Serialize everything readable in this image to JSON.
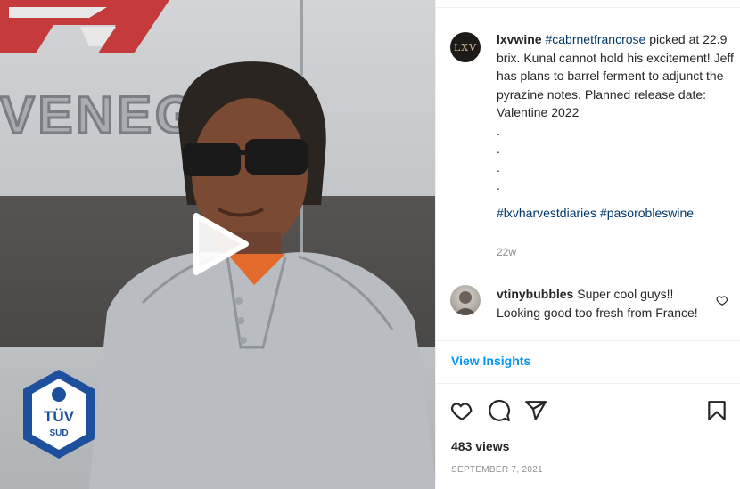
{
  "post": {
    "author": {
      "username": "lxvwine",
      "avatar_text": "LXV"
    },
    "caption": {
      "tag_rose": "#cabrnetfrancrose",
      "text_main": " picked at 22.9 brix. Kunal cannot hold his excitement! Jeff has plans to barrel ferment to adjunct the pyrazine notes. Planned release date: Valentine 2022",
      "dots": [
        ".",
        ".",
        ".",
        "."
      ],
      "tag_harvest": "#lxvharvestdiaries",
      "tag_paso": "#pasorobleswine"
    },
    "time_ago": "22w",
    "comments": [
      {
        "username": "vtinybubbles",
        "text": " Super cool guys!! Looking good too fresh from France!"
      }
    ],
    "view_insights_label": "View Insights",
    "views": "483 views",
    "date": "SEPTEMBER 7, 2021"
  },
  "media": {
    "brand_text": "VENEGA",
    "sticker_text": "TÜV",
    "sticker_sub": "SÜD"
  },
  "icons": {
    "like": "heart-icon",
    "comment": "comment-icon",
    "share": "share-icon",
    "save": "bookmark-icon",
    "play": "play-icon",
    "comment_like": "heart-icon"
  },
  "colors": {
    "link": "#00376b",
    "accent": "#0095f6",
    "muted": "#8e8e8e"
  }
}
